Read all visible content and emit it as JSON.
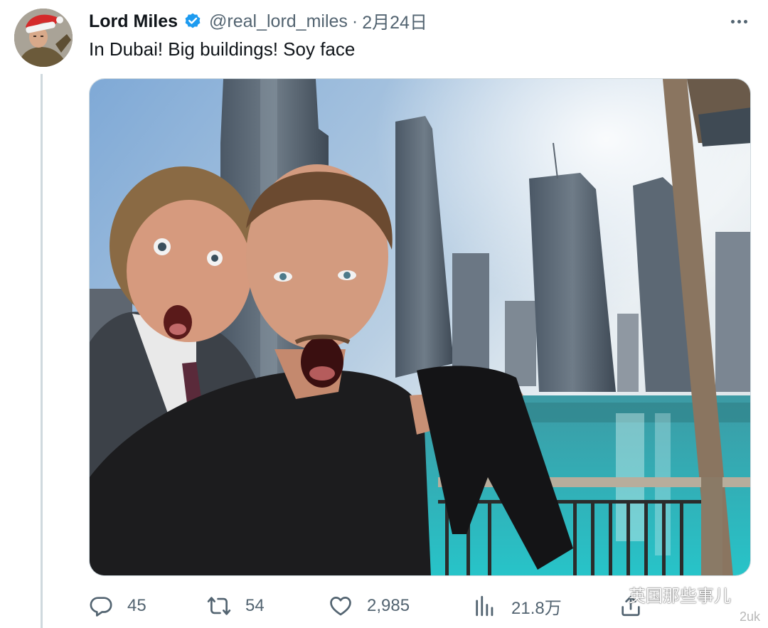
{
  "tweet": {
    "display_name": "Lord Miles",
    "handle": "@real_lord_miles",
    "separator": "·",
    "date": "2月24日",
    "text": "In Dubai! Big buildings! Soy face",
    "verified": true
  },
  "photo": {
    "alt_subject": "selfie-two-men-dubai-skyline"
  },
  "actions": {
    "reply_count": "45",
    "retweet_count": "54",
    "like_count": "2,985",
    "view_count": "21.8万"
  },
  "watermark": {
    "text": "英国那些事儿",
    "sub_text": "2uk"
  },
  "colors": {
    "text_primary": "#0f1419",
    "text_secondary": "#536471",
    "verified_blue": "#1d9bf0",
    "border": "#cfd9de"
  },
  "icons": {
    "more": "more-horizontal-icon",
    "verified": "verified-badge-icon",
    "reply": "reply-icon",
    "retweet": "retweet-icon",
    "like": "heart-icon",
    "views": "analytics-icon",
    "share": "share-icon",
    "watermark": "wechat-icon"
  }
}
